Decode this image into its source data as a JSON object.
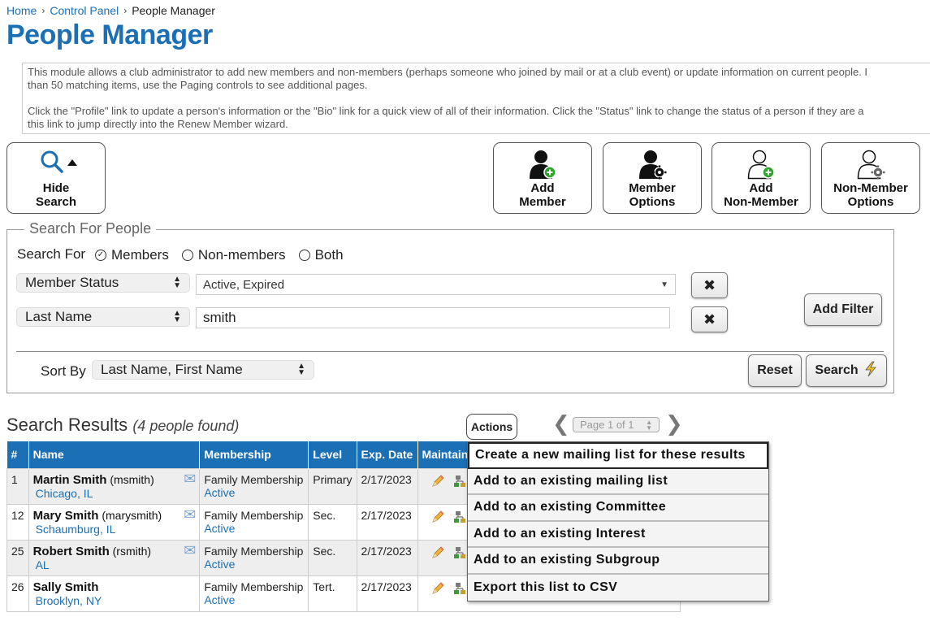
{
  "breadcrumb": {
    "home": "Home",
    "control_panel": "Control Panel",
    "current": "People Manager",
    "separator": "›"
  },
  "page_title": "People Manager",
  "intro": {
    "p1_line1": "This module allows a club administrator to add new members and non-members (perhaps someone who joined by mail or at a club event) or update information on current people. I",
    "p1_line2": "than 50 matching items, use the Paging controls to see additional pages.",
    "p2_line1": "Click the \"Profile\" link to update a person's information or the \"Bio\" link for a quick view of all of their information. Click the \"Status\" link to change the status of a person if they are a",
    "p2_line2": "this link to jump directly into the Renew Member wizard."
  },
  "toolbar": {
    "hide_search": {
      "line1": "Hide",
      "line2": "Search"
    },
    "add_member": {
      "line1": "Add",
      "line2": "Member"
    },
    "member_options": {
      "line1": "Member",
      "line2": "Options"
    },
    "add_non_member": {
      "line1": "Add",
      "line2": "Non-Member"
    },
    "non_member_options": {
      "line1": "Non-Member",
      "line2": "Options"
    }
  },
  "search": {
    "legend": "Search For People",
    "search_for_label": "Search For",
    "options": [
      "Members",
      "Non-members",
      "Both"
    ],
    "selected_option": "Members",
    "filters": [
      {
        "field": "Member Status",
        "value": "Active, Expired"
      },
      {
        "field": "Last Name",
        "value": "smith"
      }
    ],
    "add_filter": "Add Filter",
    "sort_by_label": "Sort By",
    "sort_by_value": "Last Name, First Name",
    "reset": "Reset",
    "search": "Search"
  },
  "results": {
    "title": "Search Results",
    "count": "(4 people found)",
    "actions": "Actions",
    "pager": "Page 1 of 1",
    "columns": [
      "#",
      "Name",
      "Membership",
      "Level",
      "Exp. Date",
      "Maintain"
    ],
    "rows": [
      {
        "num": "1",
        "name": "Martin Smith",
        "user": "(msmith)",
        "location": "Chicago, IL",
        "membership": "Family Membership",
        "status": "Active",
        "level": "Primary",
        "exp": "2/17/2023"
      },
      {
        "num": "12",
        "name": "Mary Smith",
        "user": "(marysmith)",
        "location": "Schaumburg, IL",
        "membership": "Family Membership",
        "status": "Active",
        "level": "Sec.",
        "exp": "2/17/2023"
      },
      {
        "num": "25",
        "name": "Robert Smith",
        "user": "(rsmith)",
        "location": "AL",
        "membership": "Family Membership",
        "status": "Active",
        "level": "Sec.",
        "exp": "2/17/2023"
      },
      {
        "num": "26",
        "name": "Sally Smith",
        "user": "",
        "location": "Brooklyn, NY",
        "membership": "Family Membership",
        "status": "Active",
        "level": "Tert.",
        "exp": "2/17/2023"
      }
    ]
  },
  "actions_menu": [
    "Create a new mailing list for these results",
    "Add to an existing mailing list",
    "Add to an existing Committee",
    "Add to an existing Interest",
    "Add to an existing Subgroup",
    "Export this list to CSV"
  ],
  "colors": {
    "brand_blue": "#1a6fb5",
    "add_green": "#2aa52a"
  }
}
